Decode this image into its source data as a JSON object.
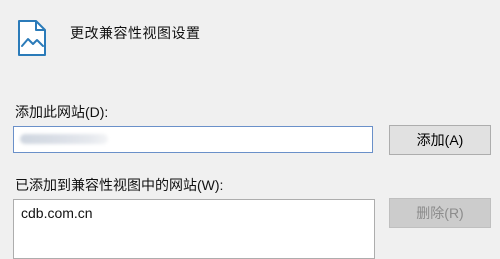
{
  "header": {
    "title": "更改兼容性视图设置",
    "icon": "compatibility-view-page-icon"
  },
  "add_site": {
    "label": "添加此网站(D):",
    "input_value": "",
    "add_button_label": "添加(A)"
  },
  "site_list": {
    "label": "已添加到兼容性视图中的网站(W):",
    "items": [
      "cdb.com.cn"
    ],
    "remove_button_label": "删除(R)"
  },
  "colors": {
    "background": "#f0f0f0",
    "input_border_focus": "#6a90c9",
    "icon_stroke": "#2b7bb9"
  }
}
